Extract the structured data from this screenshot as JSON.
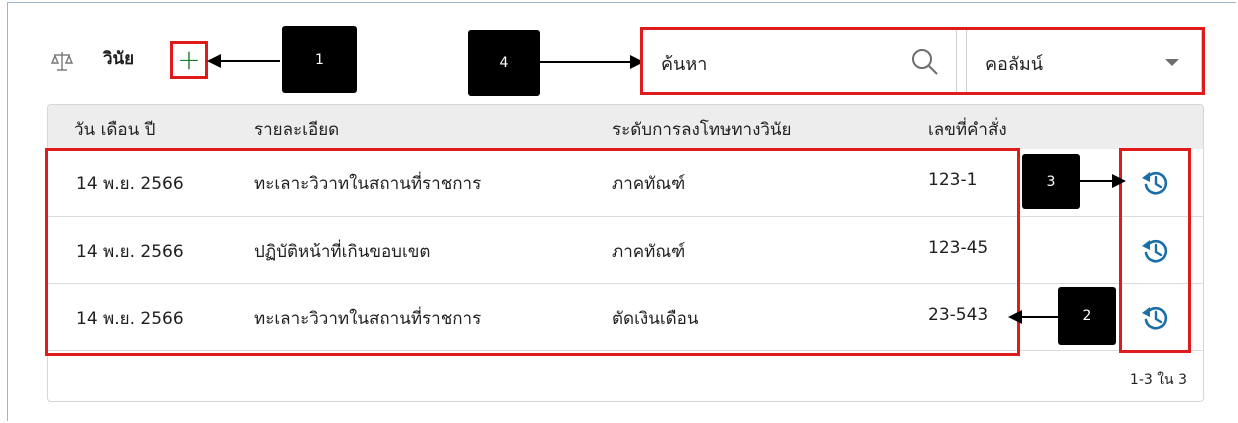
{
  "header": {
    "title_icon": "scale-icon",
    "title": "วินัย",
    "add_icon": "plus-icon",
    "add_label": "+"
  },
  "search": {
    "value": "ค้นหา",
    "icon": "search-icon"
  },
  "column_select": {
    "value": "คอลัมน์",
    "icon": "chevron-down-icon"
  },
  "table": {
    "columns": [
      "วัน เดือน ปี",
      "รายละเอียด",
      "ระดับการลงโทษทางวินัย",
      "เลขที่คำสั่ง"
    ],
    "rows": [
      {
        "date": "14 พ.ย. 2566",
        "detail": "ทะเลาะวิวาทในสถานที่ราชการ",
        "level": "ภาคทัณฑ์",
        "order_no": "123-1",
        "action_icon": "history-icon"
      },
      {
        "date": "14 พ.ย. 2566",
        "detail": "ปฏิบัติหน้าที่เกินขอบเขต",
        "level": "ภาคทัณฑ์",
        "order_no": "123-45",
        "action_icon": "history-icon"
      },
      {
        "date": "14 พ.ย. 2566",
        "detail": "ทะเลาะวิวาทในสถานที่ราชการ",
        "level": "ตัดเงินเดือน",
        "order_no": "23-543",
        "action_icon": "history-icon"
      }
    ],
    "pagination": "1-3 ใน 3"
  },
  "callouts": [
    "1",
    "2",
    "3",
    "4"
  ],
  "colors": {
    "highlight": "#e01b1b",
    "accent_icon": "#1a6fa8",
    "add_icon": "#1a7a2a",
    "header_bg": "#ededed"
  }
}
